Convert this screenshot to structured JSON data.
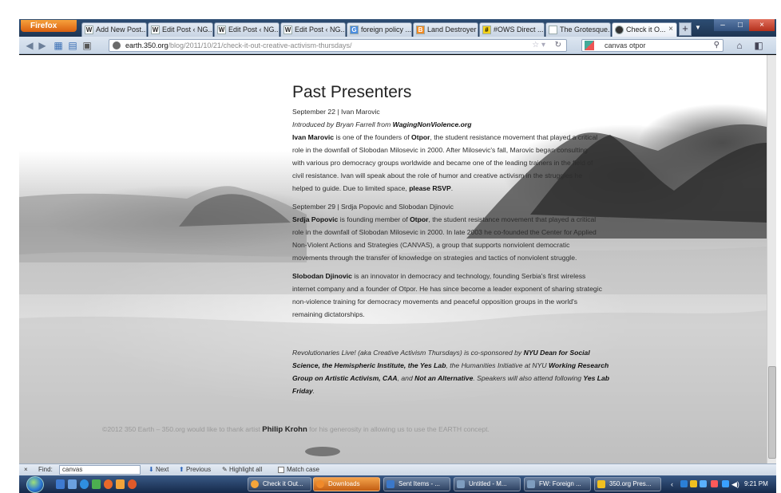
{
  "browser": {
    "menu_button": "Firefox",
    "tabs": [
      {
        "label": "Add New Post...",
        "icon": "W"
      },
      {
        "label": "Edit Post ‹ NG...",
        "icon": "W"
      },
      {
        "label": "Edit Post ‹ NG...",
        "icon": "W"
      },
      {
        "label": "Edit Post ‹ NG...",
        "icon": "W"
      },
      {
        "label": "foreign policy ...",
        "icon": "G"
      },
      {
        "label": "Land Destroyer",
        "icon": "B"
      },
      {
        "label": "#OWS Direct ...",
        "icon": "#"
      },
      {
        "label": "The Grotesque...",
        "icon": ""
      },
      {
        "label": "Check it O...",
        "icon": "●"
      }
    ],
    "url_host": "earth.350.org",
    "url_path": "/blog/2011/10/21/check-it-out-creative-activism-thursdays/",
    "search_value": "canvas otpor",
    "colors": {
      "accent": "#e66a1e",
      "chrome": "#c8d5e5"
    }
  },
  "page": {
    "heading": "Past Presenters",
    "event1_date": "September 22 | Ivan Marovic",
    "event1_intro_prefix": "Introduced by Bryan Farrell from ",
    "event1_intro_site": "WagingNonViolence.org",
    "event1_lines": [
      {
        "bold": "Ivan Marovic",
        "rest": " is one of the founders of ",
        "bold2": "Otpor",
        "rest2": ", the student resistance movement that played a critical"
      },
      {
        "bold": "",
        "rest": "role in the downfall of Slobodan Milosevic in 2000. After Milosevic's fall, Marovic began consulting",
        "bold2": "",
        "rest2": ""
      },
      {
        "bold": "",
        "rest": "with various pro democracy groups worldwide and became one of the leading trainers in the field of",
        "bold2": "",
        "rest2": ""
      },
      {
        "bold": "",
        "rest": "civil resistance. Ivan will speak about the role of humor and creative activism in the struggles he",
        "bold2": "",
        "rest2": ""
      },
      {
        "bold": "",
        "rest": "helped to guide. Due to limited space, ",
        "bold2": "please RSVP",
        "rest2": "."
      }
    ],
    "event2_date": "September 29 | Srdja Popovic and Slobodan Djinovic",
    "event2_lines": [
      {
        "bold": "Srdja Popovic",
        "rest": " is founding member of ",
        "bold2": "Otpor",
        "rest2": ", the student resistance movement that played a critical"
      },
      {
        "bold": "",
        "rest": "role in the downfall of Slobodan Milosevic in 2000. In late 2003 he co-founded the Center for Applied",
        "bold2": "",
        "rest2": ""
      },
      {
        "bold": "",
        "rest": "Non-Violent Actions and Strategies (CANVAS), a group that supports nonviolent democratic",
        "bold2": "",
        "rest2": ""
      },
      {
        "bold": "",
        "rest": "movements through the transfer of knowledge on strategies and tactics of nonviolent struggle.",
        "bold2": "",
        "rest2": ""
      }
    ],
    "event3_lines": [
      {
        "bold": "Slobodan Djinovic",
        "rest": " is an innovator in democracy and technology, founding Serbia's first wireless",
        "bold2": "",
        "rest2": ""
      },
      {
        "bold": "",
        "rest": "internet company and a founder of Otpor. He has since become a leader exponent of sharing strategic",
        "bold2": "",
        "rest2": ""
      },
      {
        "bold": "",
        "rest": "non-violence training for democracy movements and peaceful opposition groups in the world's",
        "bold2": "",
        "rest2": ""
      },
      {
        "bold": "",
        "rest": "remaining dictatorships.",
        "bold2": "",
        "rest2": ""
      }
    ],
    "sponsor_lines": [
      {
        "it": "Revolutionaries Live! (aka Creative Activism Thursdays) is co-sponsored by ",
        "b": "NYU Dean for Social"
      },
      {
        "it": "",
        "b": "Science, the Hemispheric Institute, the Yes Lab",
        "it2": ", the Humanities Initiative at NYU ",
        "b2": "Working Research"
      },
      {
        "it": "",
        "b": "Group on Artistic Activism, CAA",
        "it2": ", and ",
        "b2": "Not an Alternative",
        "it3": ". Speakers will also attend following ",
        "b3": "Yes Lab"
      },
      {
        "it": "",
        "b": "Friday",
        "it2": "."
      }
    ],
    "credit_prefix": "©2012 350 Earth – 350.org would like to thank artist ",
    "credit_artist": "Philip Krohn",
    "credit_suffix": " for his generosity in allowing us to use the EARTH concept."
  },
  "findbar": {
    "close": "×",
    "label": "Find:",
    "value": "canvas",
    "next": "Next",
    "previous": "Previous",
    "highlight": "Highlight all",
    "match_case": "Match case"
  },
  "taskbar": {
    "items": [
      {
        "label": "Check it Out...",
        "color": "#f5a53a",
        "active": false
      },
      {
        "label": "Downloads",
        "color": "#f08a2a",
        "active": true
      },
      {
        "label": "Sent Items - ...",
        "color": "#3b78c9",
        "active": false
      },
      {
        "label": "Untitled - M...",
        "color": "#7e9dbf",
        "active": false
      },
      {
        "label": "FW: Foreign ...",
        "color": "#7e9dbf",
        "active": false
      },
      {
        "label": "350.org Pres...",
        "color": "#f0c020",
        "active": false
      }
    ],
    "clock": "9:21 PM"
  }
}
